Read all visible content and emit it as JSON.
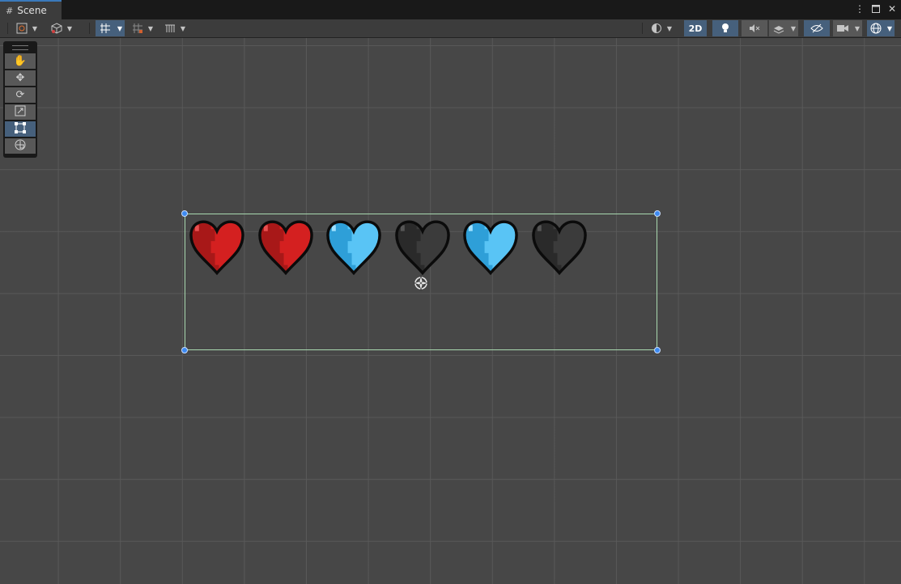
{
  "window": {
    "tab_label": "Scene",
    "tab_icon": "grid-icon",
    "controls": [
      "more-options-icon",
      "maximize-icon",
      "close-icon"
    ]
  },
  "toolbar": {
    "left_buttons": [
      "draw-mode-icon",
      "3d-gizmo-icon",
      "snap-grid-icon",
      "increment-snap-icon",
      "grid-visibility-icon"
    ],
    "right_buttons": [
      "shading-icon",
      "2d-toggle",
      "lighting-icon",
      "audio-mute-icon",
      "effects-icon",
      "hidden-objects-icon",
      "camera-icon",
      "gizmos-icon"
    ],
    "mode_2d_label": "2D"
  },
  "tools": [
    "hand-tool",
    "move-tool",
    "rotate-tool",
    "scale-tool",
    "rect-tool",
    "transform-tool"
  ],
  "active_tool": "rect-tool",
  "hearts": [
    {
      "color": "red"
    },
    {
      "color": "red"
    },
    {
      "color": "blue"
    },
    {
      "color": "dark"
    },
    {
      "color": "blue"
    },
    {
      "color": "dark"
    }
  ],
  "colors": {
    "red": "#d42020",
    "red_shade": "#a81818",
    "red_hi": "#e85050",
    "blue": "#59c4f5",
    "blue_shade": "#2e9fd8",
    "blue_hi": "#9ee0ff",
    "dark": "#3b3b3b",
    "dark_shade": "#2a2a2a",
    "dark_hi": "#555555",
    "outline": "#0b0b0b",
    "selection": "#a9d9b0",
    "handle": "#3d8af2",
    "accent_active": "#46607c"
  }
}
